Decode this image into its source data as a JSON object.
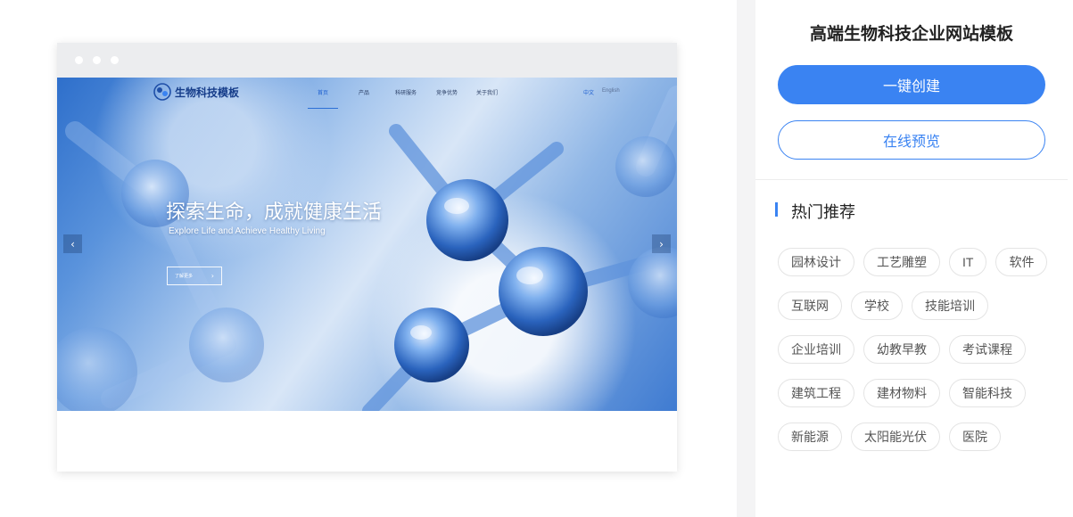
{
  "preview": {
    "site": {
      "logo_text": "生物科技模板",
      "nav": [
        "首页",
        "产品",
        "科研服务",
        "竞争优势",
        "关于我们"
      ],
      "lang_cn": "中文",
      "lang_en": "English",
      "hero_title": "探索生命，成就健康生活",
      "hero_subtitle": "Explore Life and Achieve Healthy Living",
      "hero_button": "了解更多",
      "prev_arrow": "‹",
      "next_arrow": "›"
    }
  },
  "panel": {
    "title": "高端生物科技企业网站模板",
    "create_button": "一键创建",
    "preview_button": "在线预览",
    "section_title": "热门推荐",
    "tags": [
      [
        "园林设计",
        "工艺雕塑",
        "IT",
        "软件"
      ],
      [
        "互联网",
        "学校",
        "技能培训"
      ],
      [
        "企业培训",
        "幼教早教",
        "考试课程"
      ],
      [
        "建筑工程",
        "建材物料",
        "智能科技"
      ],
      [
        "新能源",
        "太阳能光伏",
        "医院"
      ]
    ]
  },
  "colors": {
    "accent": "#3a83f2",
    "gutter": "#f4f4f5",
    "browser_bar": "#ecedef"
  }
}
